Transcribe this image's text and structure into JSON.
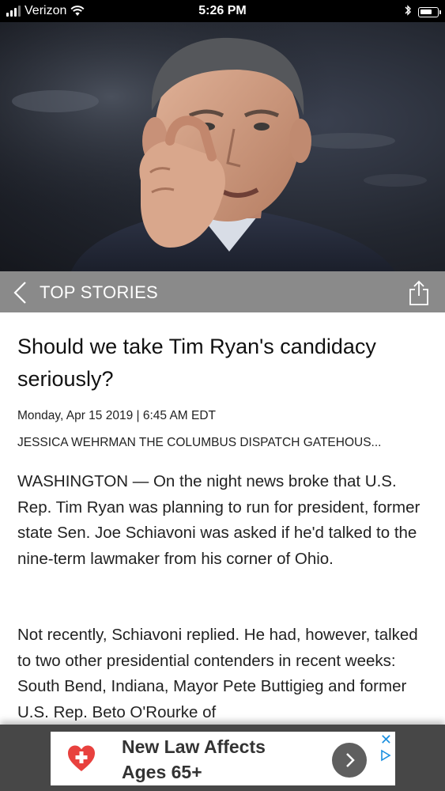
{
  "status_bar": {
    "carrier": "Verizon",
    "time": "5:26 PM"
  },
  "hero": {
    "description": "photo-of-speaker"
  },
  "nav": {
    "section_title": "TOP STORIES"
  },
  "article": {
    "headline": "Should we take Tim Ryan's candidacy seriously?",
    "dateline": "Monday, Apr 15 2019 | 6:45 AM EDT",
    "byline": "JESSICA WEHRMAN THE COLUMBUS DISPATCH GATEHOUS...",
    "paragraphs": [
      "WASHINGTON — On the night news broke that U.S. Rep. Tim Ryan was planning to run for president, former state Sen. Joe Schiavoni was asked if he'd talked to the nine-term lawmaker from his corner of Ohio.",
      "Not recently, Schiavoni replied. He had, however, talked to two other presidential contenders in recent weeks: South Bend, Indiana, Mayor Pete Buttigieg and former U.S. Rep. Beto O'Rourke of"
    ]
  },
  "ad": {
    "line1": "New Law Affects",
    "line2": "Ages 65+",
    "close_label": "✕"
  },
  "colors": {
    "nav_bar": "#8a8a8a",
    "ad_background": "#474747",
    "ad_icon_red": "#e8413e",
    "adchoice_blue": "#1a8fe0"
  }
}
